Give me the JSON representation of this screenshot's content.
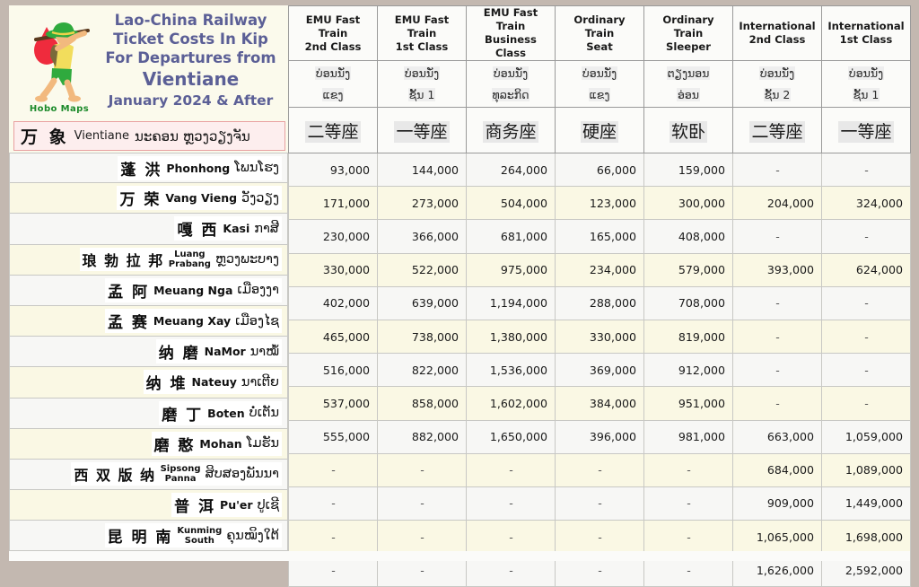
{
  "document": {
    "title_lines": [
      "Lao-China Railway",
      "Ticket Costs In Kip",
      "For Departures from",
      "Vientiane",
      "January 2024 & After"
    ],
    "logo_caption": "Hobo Maps",
    "logo_icon": "hobo-with-bindle-icon",
    "accent_color": "#5b5f96",
    "highlight_border_color": "#e8a0a0",
    "highlight_fill_color": "#fdeeee"
  },
  "origin": {
    "cn": "万 象",
    "en": "Vientiane",
    "lo": "ນະຄອນ ຫຼວງວຽງຈັນ"
  },
  "columns": [
    {
      "en": "EMU Fast Train\n2nd Class",
      "en_l1": "EMU Fast Train",
      "en_l2": "2nd Class",
      "lo_l1": "ບ່ອນນັ່ງ",
      "lo_l2": "ແຂງ",
      "cn": "二等座"
    },
    {
      "en": "EMU Fast Train\n1st Class",
      "en_l1": "EMU Fast Train",
      "en_l2": "1st Class",
      "lo_l1": "ບ່ອນນັ່ງ",
      "lo_l2": "ຊັ້ນ 1",
      "cn": "一等座"
    },
    {
      "en": "EMU Fast Train\nBusiness Class",
      "en_l1": "EMU Fast Train",
      "en_l2": "Business Class",
      "lo_l1": "ບ່ອນນັ່ງ",
      "lo_l2": "ທຸລະກິດ",
      "cn": "商务座"
    },
    {
      "en": "Ordinary Train\nSeat",
      "en_l1": "Ordinary Train",
      "en_l2": "Seat",
      "lo_l1": "ບ່ອນນັ່ງ",
      "lo_l2": "ແຂງ",
      "cn": "硬座"
    },
    {
      "en": "Ordinary Train\nSleeper",
      "en_l1": "Ordinary Train",
      "en_l2": "Sleeper",
      "lo_l1": "ຕຽງນອນ",
      "lo_l2": "ອ່ອນ",
      "cn": "软卧"
    },
    {
      "en": "International\n2nd Class",
      "en_l1": "International",
      "en_l2": "2nd Class",
      "lo_l1": "ບ່ອນນັ່ງ",
      "lo_l2": "ຊັ້ນ 2",
      "cn": "二等座"
    },
    {
      "en": "International\n1st Class",
      "en_l1": "International",
      "en_l2": "1st Class",
      "lo_l1": "ບ່ອນນັ່ງ",
      "lo_l2": "ຊັ້ນ 1",
      "cn": "一等座"
    }
  ],
  "rows": [
    {
      "cn": "蓬 洪",
      "en": "Phonhong",
      "en2": "",
      "lo": "ໂພນໂຮງ",
      "values": [
        "93,000",
        "144,000",
        "264,000",
        "66,000",
        "159,000",
        "-",
        "-"
      ]
    },
    {
      "cn": "万 荣",
      "en": "Vang Vieng",
      "en2": "",
      "lo": "ວັງວຽງ",
      "values": [
        "171,000",
        "273,000",
        "504,000",
        "123,000",
        "300,000",
        "204,000",
        "324,000"
      ]
    },
    {
      "cn": "嘎 西",
      "en": "Kasi",
      "en2": "",
      "lo": "ກາສີ",
      "values": [
        "230,000",
        "366,000",
        "681,000",
        "165,000",
        "408,000",
        "-",
        "-"
      ]
    },
    {
      "cn": "琅 勃 拉 邦",
      "en": "Luang",
      "en2": "Prabang",
      "lo": "ຫຼວງພະບາງ",
      "values": [
        "330,000",
        "522,000",
        "975,000",
        "234,000",
        "579,000",
        "393,000",
        "624,000"
      ]
    },
    {
      "cn": "孟 阿",
      "en": "Meuang Nga",
      "en2": "",
      "lo": "ເມືອງງາ",
      "values": [
        "402,000",
        "639,000",
        "1,194,000",
        "288,000",
        "708,000",
        "-",
        "-"
      ]
    },
    {
      "cn": "孟 赛",
      "en": "Meuang Xay",
      "en2": "",
      "lo": "ເມືອງໄຊ",
      "values": [
        "465,000",
        "738,000",
        "1,380,000",
        "330,000",
        "819,000",
        "-",
        "-"
      ]
    },
    {
      "cn": "纳 磨",
      "en": "NaMor",
      "en2": "",
      "lo": "ນາໝໍ້",
      "values": [
        "516,000",
        "822,000",
        "1,536,000",
        "369,000",
        "912,000",
        "-",
        "-"
      ]
    },
    {
      "cn": "纳 堆",
      "en": "Nateuy",
      "en2": "",
      "lo": "ນາເຕີຍ",
      "values": [
        "537,000",
        "858,000",
        "1,602,000",
        "384,000",
        "951,000",
        "-",
        "-"
      ]
    },
    {
      "cn": "磨 丁",
      "en": "Boten",
      "en2": "",
      "lo": "ບໍ່ເຕັນ",
      "values": [
        "555,000",
        "882,000",
        "1,650,000",
        "396,000",
        "981,000",
        "663,000",
        "1,059,000"
      ]
    },
    {
      "cn": "磨 憨",
      "en": "Mohan",
      "en2": "",
      "lo": "ໂມຮັນ",
      "values": [
        "-",
        "-",
        "-",
        "-",
        "-",
        "684,000",
        "1,089,000"
      ]
    },
    {
      "cn": "西 双 版 纳",
      "en": "Sipsong",
      "en2": "Panna",
      "lo": "ສິບສອງພັນນາ",
      "values": [
        "-",
        "-",
        "-",
        "-",
        "-",
        "909,000",
        "1,449,000"
      ]
    },
    {
      "cn": "普 洱",
      "en": "Pu'er",
      "en2": "",
      "lo": "ປູເຊີ",
      "values": [
        "-",
        "-",
        "-",
        "-",
        "-",
        "1,065,000",
        "1,698,000"
      ]
    },
    {
      "cn": "昆 明 南",
      "en": "Kunming",
      "en2": "South",
      "lo": "ຄຸນໝິງໃຕ້",
      "values": [
        "-",
        "-",
        "-",
        "-",
        "-",
        "1,626,000",
        "2,592,000"
      ]
    }
  ]
}
